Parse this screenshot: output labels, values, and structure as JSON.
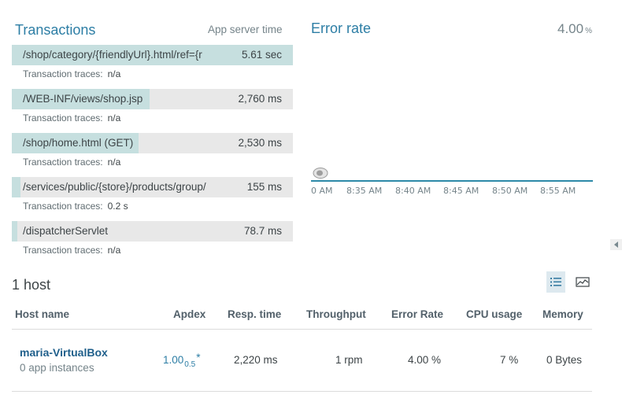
{
  "transactions": {
    "title": "Transactions",
    "subtitle": "App server time",
    "trace_label": "Transaction traces:",
    "items": [
      {
        "name": "/shop/category/{friendlyUrl}.html/ref={r",
        "time": "5.61 sec",
        "traces": "n/a",
        "share": 1.0
      },
      {
        "name": "/WEB-INF/views/shop.jsp",
        "time": "2,760 ms",
        "traces": "n/a",
        "share": 0.49
      },
      {
        "name": "/shop/home.html (GET)",
        "time": "2,530 ms",
        "traces": "n/a",
        "share": 0.45
      },
      {
        "name": "/services/public/{store}/products/group/",
        "time": "155 ms",
        "traces": "0.2 s",
        "share": 0.03
      },
      {
        "name": "/dispatcherServlet",
        "time": "78.7 ms",
        "traces": "n/a",
        "share": 0.014
      }
    ]
  },
  "error_rate": {
    "title": "Error rate",
    "value": "4.00",
    "unit": "%",
    "chart_data": {
      "type": "line",
      "x_ticks": [
        "0 AM",
        "8:35 AM",
        "8:40 AM",
        "8:45 AM",
        "8:50 AM",
        "8:55 AM"
      ],
      "line_color": "#2d8aa8"
    }
  },
  "hosts": {
    "title": "1 host",
    "view_list_icon": "list-icon",
    "view_chart_icon": "chart-icon",
    "columns": [
      "Host name",
      "Apdex",
      "Resp. time",
      "Throughput",
      "Error Rate",
      "CPU usage",
      "Memory"
    ],
    "rows": [
      {
        "name": "maria-VirtualBox",
        "instances": "0 app instances",
        "apdex": "1.00",
        "apdex_t": "0.5",
        "apdex_mark": "*",
        "resp_time": "2,220 ms",
        "throughput": "1 rpm",
        "error_rate": "4.00 %",
        "cpu": "7 %",
        "memory": "0 Bytes"
      }
    ]
  }
}
